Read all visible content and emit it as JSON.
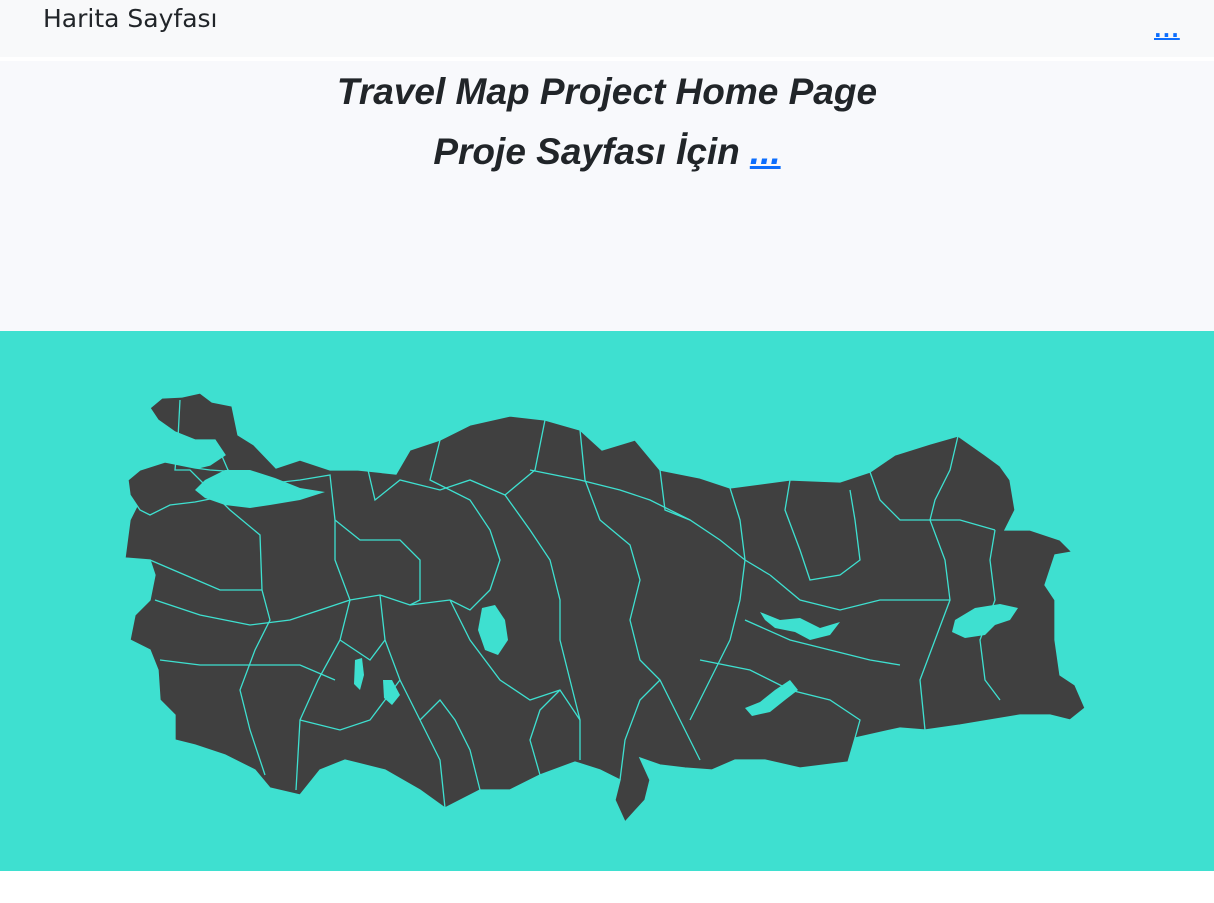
{
  "navbar": {
    "brand": "Harita Sayfası",
    "more_link": "..."
  },
  "hero": {
    "title": "Travel Map Project Home Page",
    "subtitle": "Proje Sayfası İçin",
    "subtitle_link": "..."
  },
  "map": {
    "region": "Turkey provinces",
    "land_color": "#404040",
    "background_color": "#3ee0d0",
    "border_color": "#3ee0d0"
  }
}
